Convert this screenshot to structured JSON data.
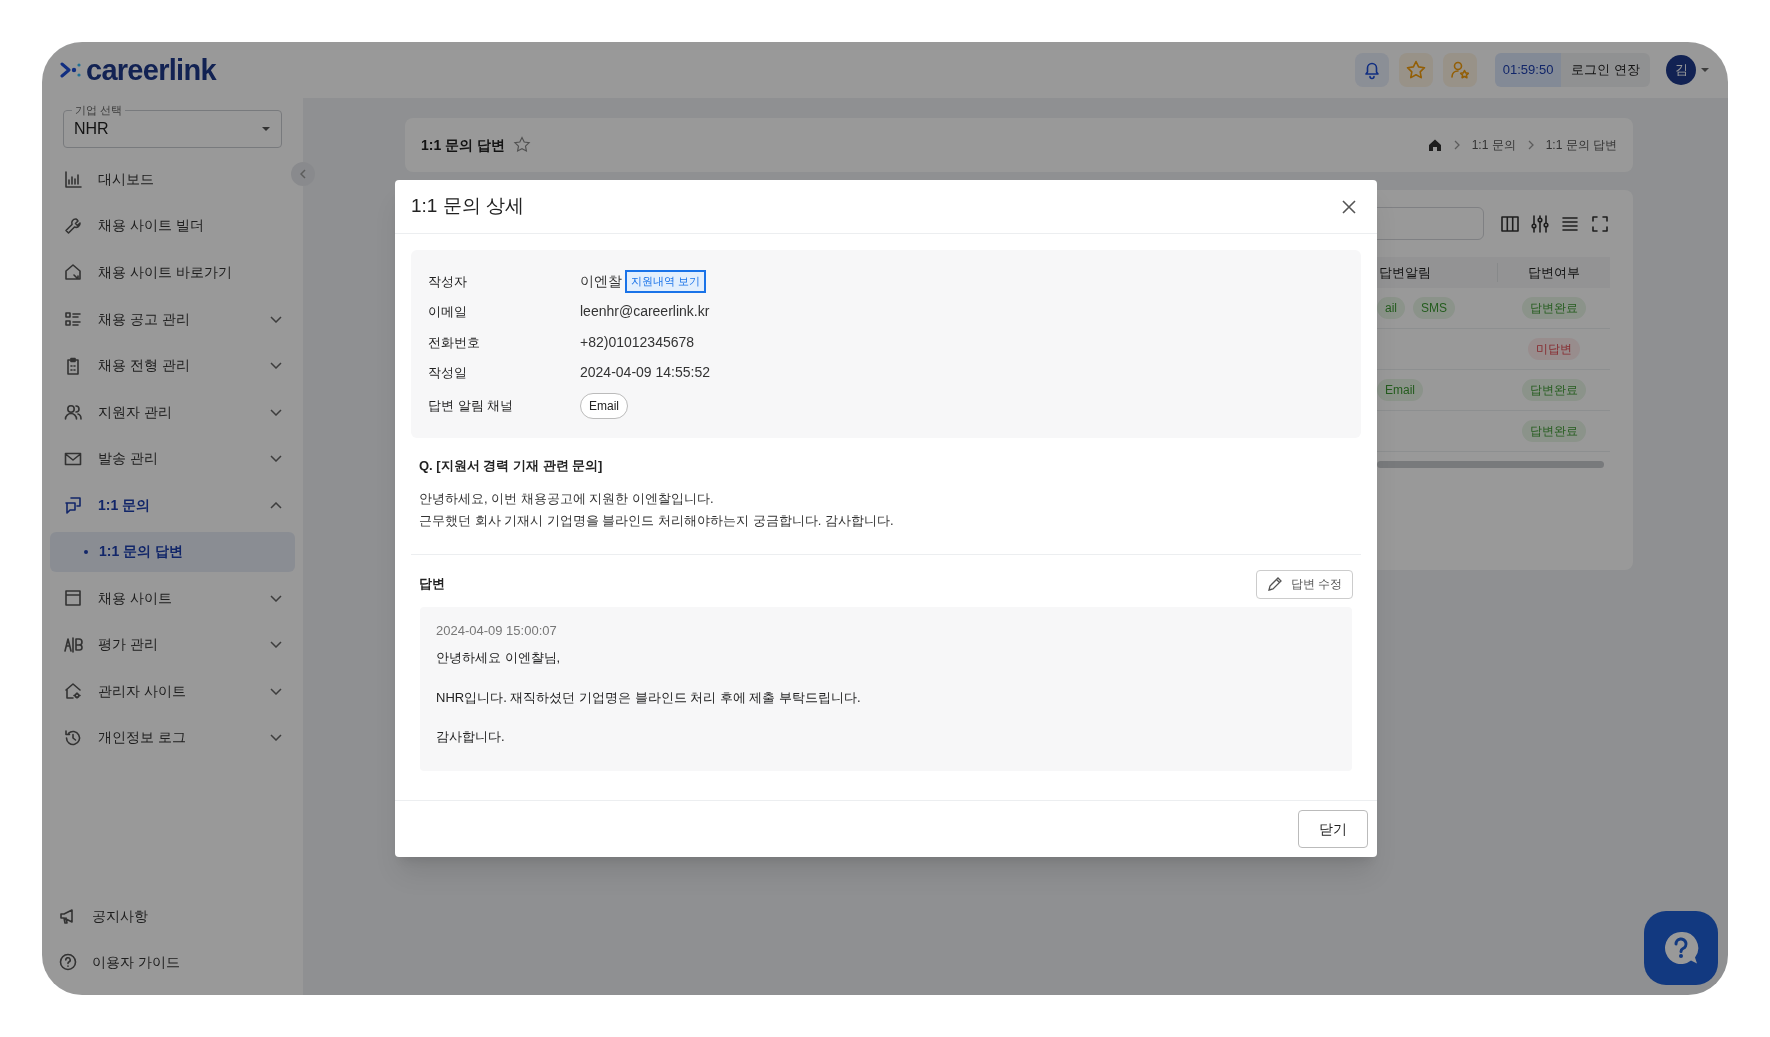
{
  "header": {
    "logo": "careerlink",
    "timer": "01:59:50",
    "extend_button": "로그인 연장",
    "avatar": "김"
  },
  "company_select": {
    "label": "기업 선택",
    "value": "NHR"
  },
  "sidebar": {
    "items": [
      {
        "label": "대시보드",
        "kind": "link",
        "selected": false
      },
      {
        "label": "채용 사이트 빌더",
        "kind": "link",
        "selected": false
      },
      {
        "label": "채용 사이트 바로가기",
        "kind": "link",
        "selected": false
      },
      {
        "label": "채용 공고 관리",
        "kind": "group",
        "expanded": false,
        "selected": false
      },
      {
        "label": "채용 전형 관리",
        "kind": "group",
        "expanded": false,
        "selected": false
      },
      {
        "label": "지원자 관리",
        "kind": "group",
        "expanded": false,
        "selected": false
      },
      {
        "label": "발송 관리",
        "kind": "group",
        "expanded": false,
        "selected": false
      },
      {
        "label": "1:1 문의",
        "kind": "group",
        "expanded": true,
        "selected": true,
        "children": [
          {
            "label": "1:1 문의 답변",
            "selected": true
          }
        ]
      },
      {
        "label": "채용 사이트",
        "kind": "group",
        "expanded": false,
        "selected": false
      },
      {
        "label": "평가 관리",
        "kind": "group",
        "expanded": false,
        "selected": false
      },
      {
        "label": "관리자 사이트",
        "kind": "group",
        "expanded": false,
        "selected": false
      },
      {
        "label": "개인정보 로그",
        "kind": "group",
        "expanded": false,
        "selected": false
      }
    ],
    "footer": [
      "공지사항",
      "이용자 가이드"
    ]
  },
  "page": {
    "title": "1:1 문의 답변",
    "breadcrumb": [
      "1:1 문의",
      "1:1 문의 답변"
    ]
  },
  "table": {
    "columns": [
      "답변알림",
      "답변여부"
    ],
    "rows": [
      {
        "channels": [
          "ail",
          "SMS"
        ],
        "status": {
          "text": "답변완료",
          "kind": "done"
        }
      },
      {
        "channels": [],
        "status": {
          "text": "미답변",
          "kind": "pending"
        }
      },
      {
        "channels": [
          "Email"
        ],
        "status": {
          "text": "답변완료",
          "kind": "done"
        }
      },
      {
        "channels": [],
        "status": {
          "text": "답변완료",
          "kind": "done"
        }
      }
    ]
  },
  "modal": {
    "title": "1:1 문의 상세",
    "fields": [
      {
        "label": "작성자",
        "value": "이엔찰",
        "link": "지원내역 보기"
      },
      {
        "label": "이메일",
        "value": "leenhr@careerlink.kr"
      },
      {
        "label": "전화번호",
        "value": "+82)01012345678"
      },
      {
        "label": "작성일",
        "value": "2024-04-09 14:55:52"
      },
      {
        "label": "답변 알림 채널",
        "chips": [
          "Email"
        ]
      }
    ],
    "question_title": "Q. [지원서 경력 기재 관련 문의]",
    "question_lines": [
      "안녕하세요, 이번 채용공고에 지원한 이엔찰입니다.",
      "근무했던 회사 기재시 기업명을 블라인드 처리해야하는지 궁금합니다. 감사합니다."
    ],
    "answer_label": "답변",
    "edit_button": "답변 수정",
    "answer_date": "2024-04-09 15:00:07",
    "answer_paragraphs": [
      "안녕하세요 이엔챨님,",
      "NHR입니다. 재직하셨던 기업명은 블라인드 처리 후에 제출 부탁드립니다.",
      "감사합니다."
    ],
    "close_button": "닫기"
  }
}
